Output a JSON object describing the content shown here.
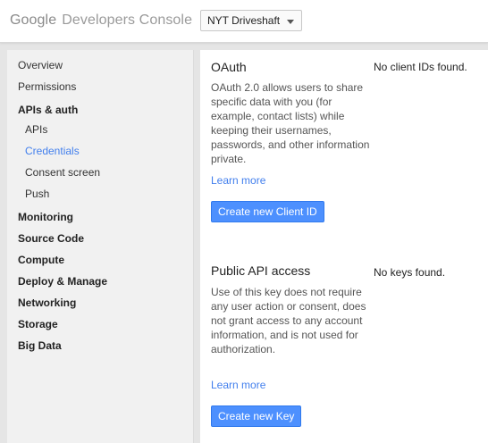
{
  "header": {
    "logo_google": "Google",
    "logo_product": "Developers Console",
    "project_name": "NYT Driveshaft"
  },
  "sidebar": {
    "items": [
      {
        "label": "Overview"
      },
      {
        "label": "Permissions"
      },
      {
        "label": "APIs & auth"
      },
      {
        "label": "APIs"
      },
      {
        "label": "Credentials"
      },
      {
        "label": "Consent screen"
      },
      {
        "label": "Push"
      },
      {
        "label": "Monitoring"
      },
      {
        "label": "Source Code"
      },
      {
        "label": "Compute"
      },
      {
        "label": "Deploy & Manage"
      },
      {
        "label": "Networking"
      },
      {
        "label": "Storage"
      },
      {
        "label": "Big Data"
      }
    ]
  },
  "oauth": {
    "title": "OAuth",
    "description": "OAuth 2.0 allows users to share specific data with you (for example, contact lists) while keeping their usernames, passwords, and other information private.",
    "learn_more": "Learn more",
    "button": "Create new Client ID",
    "status": "No client IDs found."
  },
  "public_api": {
    "title": "Public API access",
    "description": "Use of this key does not require any user action or consent, does not grant access to any account information, and is not used for authorization.",
    "learn_more": "Learn more",
    "button": "Create new Key",
    "status": "No keys found."
  },
  "colors": {
    "link": "#427fed",
    "button": "#4d90fe"
  }
}
